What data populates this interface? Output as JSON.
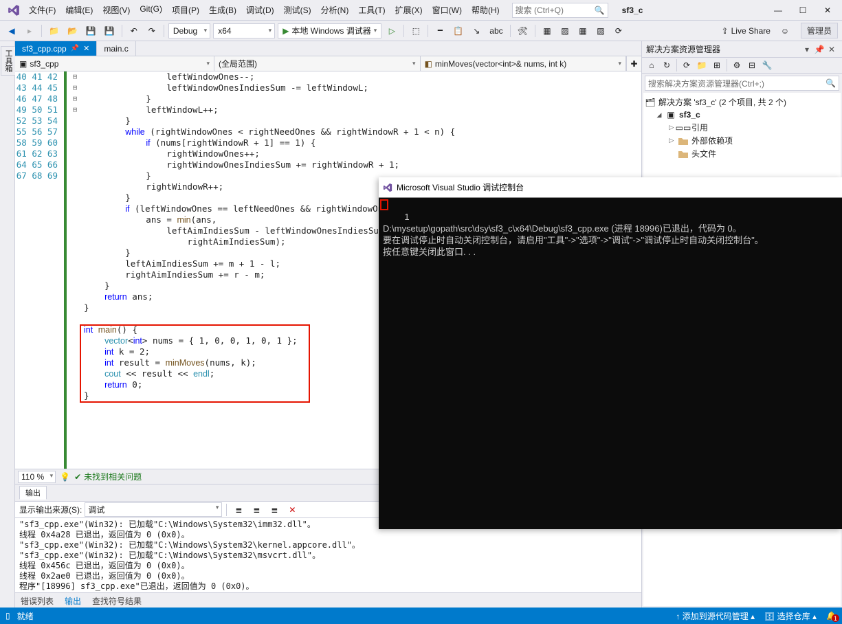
{
  "menu": {
    "file": "文件(F)",
    "edit": "编辑(E)",
    "view": "视图(V)",
    "git": "Git(G)",
    "project": "项目(P)",
    "build": "生成(B)",
    "debug": "调试(D)",
    "test": "测试(S)",
    "analyze": "分析(N)",
    "tools": "工具(T)",
    "extensions": "扩展(X)",
    "window": "窗口(W)",
    "help": "帮助(H)"
  },
  "title": {
    "search_placeholder": "搜索 (Ctrl+Q)",
    "project_name": "sf3_c",
    "admin": "管理员"
  },
  "toolbar": {
    "config": "Debug",
    "platform": "x64",
    "run": "本地 Windows 调试器",
    "live": "Live Share"
  },
  "tabs": {
    "active": "sf3_cpp.cpp",
    "other": "main.c"
  },
  "navbar": {
    "left": "sf3_cpp",
    "mid": "(全局范围)",
    "right": "minMoves(vector<int>& nums, int k)"
  },
  "code_lines": [
    {
      "n": 40,
      "f": "",
      "t": "                leftWindowOnes--;"
    },
    {
      "n": 41,
      "f": "",
      "t": "                leftWindowOnesIndiesSum -= leftWindowL;"
    },
    {
      "n": 42,
      "f": "",
      "t": "            }"
    },
    {
      "n": 43,
      "f": "",
      "t": "            leftWindowL++;"
    },
    {
      "n": 44,
      "f": "",
      "t": "        }"
    },
    {
      "n": 45,
      "f": "⊟",
      "t": "        while (rightWindowOnes < rightNeedOnes && rightWindowR + 1 < n) {"
    },
    {
      "n": 46,
      "f": "⊟",
      "t": "            if (nums[rightWindowR + 1] == 1) {"
    },
    {
      "n": 47,
      "f": "",
      "t": "                rightWindowOnes++;"
    },
    {
      "n": 48,
      "f": "",
      "t": "                rightWindowOnesIndiesSum += rightWindowR + 1;"
    },
    {
      "n": 49,
      "f": "",
      "t": "            }"
    },
    {
      "n": 50,
      "f": "",
      "t": "            rightWindowR++;"
    },
    {
      "n": 51,
      "f": "",
      "t": "        }"
    },
    {
      "n": 52,
      "f": "⊟",
      "t": "        if (leftWindowOnes == leftNeedOnes && rightWindowOnes == rightNeedOnes) {"
    },
    {
      "n": 53,
      "f": "",
      "t": "            ans = min(ans,"
    },
    {
      "n": 54,
      "f": "",
      "t": "                leftAimIndiesSum - leftWindowOnesIndiesSum + rightWindowOnesIndiesSum -"
    },
    {
      "n": 55,
      "f": "",
      "t": "                    rightAimIndiesSum);"
    },
    {
      "n": 56,
      "f": "",
      "t": "        }"
    },
    {
      "n": 57,
      "f": "",
      "t": "        leftAimIndiesSum += m + 1 - l;"
    },
    {
      "n": 58,
      "f": "",
      "t": "        rightAimIndiesSum += r - m;"
    },
    {
      "n": 59,
      "f": "",
      "t": "    }"
    },
    {
      "n": 60,
      "f": "",
      "t": "    return ans;"
    },
    {
      "n": 61,
      "f": "",
      "t": "}"
    },
    {
      "n": 62,
      "f": "",
      "t": ""
    },
    {
      "n": 63,
      "f": "⊟",
      "t": "int main() {"
    },
    {
      "n": 64,
      "f": "",
      "t": "    vector<int> nums = { 1, 0, 0, 1, 0, 1 };"
    },
    {
      "n": 65,
      "f": "",
      "t": "    int k = 2;"
    },
    {
      "n": 66,
      "f": "",
      "t": "    int result = minMoves(nums, k);"
    },
    {
      "n": 67,
      "f": "",
      "t": "    cout << result << endl;"
    },
    {
      "n": 68,
      "f": "",
      "t": "    return 0;"
    },
    {
      "n": 69,
      "f": "",
      "t": "}"
    }
  ],
  "zoom": {
    "percent": "110 %",
    "issues": "未找到相关问题"
  },
  "output": {
    "title": "输出",
    "source_label": "显示输出来源(S):",
    "source": "调试",
    "tabs": {
      "errors": "错误列表",
      "output": "输出",
      "symbols": "查找符号结果"
    },
    "lines": [
      "\"sf3_cpp.exe\"(Win32): 已加载\"C:\\Windows\\System32\\imm32.dll\"。",
      "线程 0x4a28 已退出，返回值为 0 (0x0)。",
      "\"sf3_cpp.exe\"(Win32): 已加载\"C:\\Windows\\System32\\kernel.appcore.dll\"。",
      "\"sf3_cpp.exe\"(Win32): 已加载\"C:\\Windows\\System32\\msvcrt.dll\"。",
      "线程 0x456c 已退出，返回值为 0 (0x0)。",
      "线程 0x2ae0 已退出，返回值为 0 (0x0)。",
      "程序\"[18996] sf3_cpp.exe\"已退出，返回值为 0 (0x0)。"
    ]
  },
  "solution": {
    "title": "解决方案资源管理器",
    "search_placeholder": "搜索解决方案资源管理器(Ctrl+;)",
    "root": "解决方案 'sf3_c' (2 个项目, 共 2 个)",
    "proj": "sf3_c",
    "refs": "引用",
    "extdep": "外部依赖项",
    "headers": "头文件"
  },
  "status": {
    "ready": "就绪",
    "src": "添加到源代码管理",
    "repo": "选择仓库"
  },
  "console": {
    "title": "Microsoft Visual Studio 调试控制台",
    "line1": "1",
    "body": "\nD:\\mysetup\\gopath\\src\\dsy\\sf3_c\\x64\\Debug\\sf3_cpp.exe (进程 18996)已退出，代码为 0。\n要在调试停止时自动关闭控制台，请启用\"工具\"->\"选项\"->\"调试\"->\"调试停止时自动关闭控制台\"。\n按任意键关闭此窗口. . ."
  }
}
